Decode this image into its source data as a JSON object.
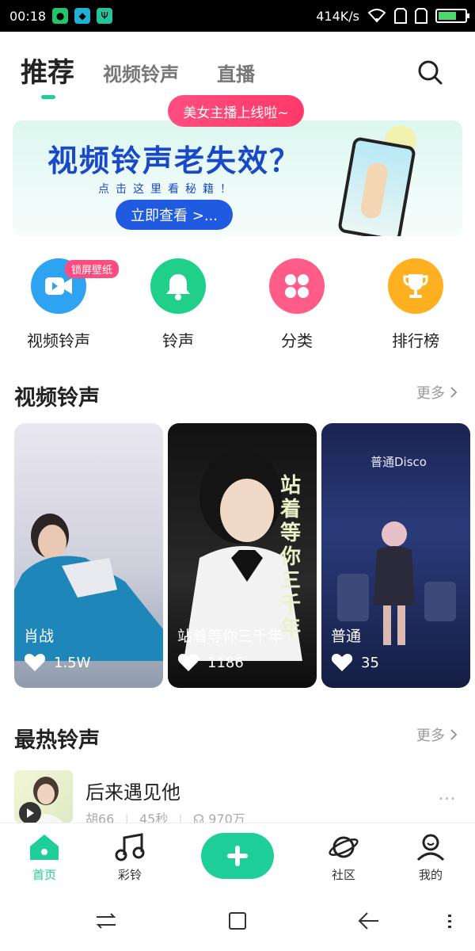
{
  "status_bar": {
    "time": "00:18",
    "net_speed": "414K/s"
  },
  "top_tabs": [
    {
      "label": "推荐"
    },
    {
      "label": "视频铃声"
    },
    {
      "label": "直播"
    }
  ],
  "live_bubble": "美女主播上线啦~",
  "banner": {
    "title": "视频铃声老失效？",
    "subtitle": "点击这里看秘籍！",
    "button": "立即查看 >..."
  },
  "shortcuts": [
    {
      "label": "视频铃声",
      "badge": "锁屏壁纸",
      "color": "#2ea3f2",
      "icon": "video-camera-icon"
    },
    {
      "label": "铃声",
      "color": "#1fcf8a",
      "icon": "bell-icon"
    },
    {
      "label": "分类",
      "color": "#ff5c8a",
      "icon": "grid-icon"
    },
    {
      "label": "排行榜",
      "color": "#ffb021",
      "icon": "trophy-icon"
    }
  ],
  "video_section": {
    "title": "视频铃声",
    "more": "更多"
  },
  "videos": [
    {
      "title": "肖战",
      "likes": "1.5W"
    },
    {
      "title": "站着等你三千年",
      "likes": "1186",
      "overlay_text": "站着等你三千年"
    },
    {
      "title": "普通",
      "likes": "35",
      "tag": "普通Disco"
    }
  ],
  "hot_section": {
    "title": "最热铃声",
    "more": "更多"
  },
  "songs": [
    {
      "name": "后来遇见他",
      "artist": "胡66",
      "duration": "45秒",
      "plays": "970万"
    }
  ],
  "bottom_nav": [
    {
      "label": "首页",
      "icon": "home-icon",
      "active": true
    },
    {
      "label": "彩铃",
      "icon": "music-note-icon"
    },
    {
      "label": "",
      "icon": "plus-icon"
    },
    {
      "label": "社区",
      "icon": "planet-icon"
    },
    {
      "label": "我的",
      "icon": "profile-icon"
    }
  ],
  "colors": {
    "accent": "#1fcf9a",
    "pink": "#ff4d7f",
    "banner_blue": "#1948c9"
  }
}
